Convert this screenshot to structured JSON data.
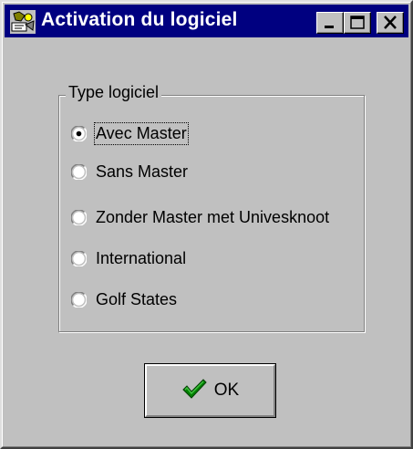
{
  "window": {
    "title": "Activation du logiciel",
    "title_bar_color": "#000080",
    "app_icon": "wizard-icon",
    "controls": [
      "minimize-icon",
      "maximize-icon",
      "close-icon"
    ]
  },
  "group": {
    "legend": "Type logiciel",
    "options": [
      {
        "label": "Avec Master",
        "selected": true
      },
      {
        "label": "Sans Master",
        "selected": false
      },
      {
        "label": "Zonder Master met Univesknoot",
        "selected": false
      },
      {
        "label": "International",
        "selected": false
      },
      {
        "label": "Golf States",
        "selected": false
      }
    ]
  },
  "ok_button": {
    "label": "OK",
    "icon": "checkmark-icon",
    "icon_color": "#008000"
  }
}
